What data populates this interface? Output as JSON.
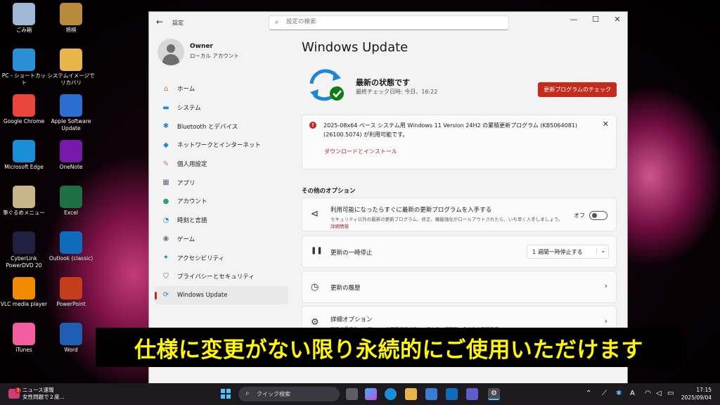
{
  "desktop": {
    "icons": [
      {
        "label": "ごみ箱",
        "icon": "recycle-bin-icon",
        "color": "#9fb8d6"
      },
      {
        "label": "将棋",
        "icon": "shogi-icon",
        "color": "#b98a3c"
      },
      {
        "label": "PC - ショートカット",
        "icon": "pc-icon",
        "color": "#2b8fd6"
      },
      {
        "label": "システムイメージでリカバリ",
        "icon": "folder-icon",
        "color": "#e7b54a"
      },
      {
        "label": "Google Chrome",
        "icon": "chrome-icon",
        "color": "#e8453c"
      },
      {
        "label": "Apple Software Update",
        "icon": "apple-update-icon",
        "color": "#2a6fd0"
      },
      {
        "label": "Microsoft Edge",
        "icon": "edge-icon",
        "color": "#1a8ed6"
      },
      {
        "label": "OneNote",
        "icon": "onenote-icon",
        "color": "#7719aa"
      },
      {
        "label": "筆ぐるめメニュー",
        "icon": "fudegurume-icon",
        "color": "#c9b58a"
      },
      {
        "label": "Excel",
        "icon": "excel-icon",
        "color": "#1d7044"
      },
      {
        "label": "CyberLink PowerDVD 20",
        "icon": "powerdvd-icon",
        "color": "#202040"
      },
      {
        "label": "Outlook (classic)",
        "icon": "outlook-icon",
        "color": "#0f6cbd"
      },
      {
        "label": "VLC media player",
        "icon": "vlc-icon",
        "color": "#f08a00"
      },
      {
        "label": "PowerPoint",
        "icon": "powerpoint-icon",
        "color": "#c43e1c"
      },
      {
        "label": "iTunes",
        "icon": "itunes-icon",
        "color": "#f25ea0"
      },
      {
        "label": "Word",
        "icon": "word-icon",
        "color": "#1e5fb4"
      }
    ]
  },
  "window": {
    "title": "設定",
    "search_placeholder": "設定の検索",
    "minimize": "—",
    "maximize": "☐",
    "close": "✕",
    "back": "←"
  },
  "user": {
    "name": "Owner",
    "subtitle": "ローカル アカウント"
  },
  "nav": [
    {
      "label": "ホーム",
      "icon": "home-icon",
      "glyph": "⌂",
      "color": "#c77a3c"
    },
    {
      "label": "システム",
      "icon": "system-icon",
      "glyph": "▬",
      "color": "#1f86d6"
    },
    {
      "label": "Bluetooth とデバイス",
      "icon": "bluetooth-icon",
      "glyph": "✱",
      "color": "#1f86d6"
    },
    {
      "label": "ネットワークとインターネット",
      "icon": "network-icon",
      "glyph": "◆",
      "color": "#1f86d6"
    },
    {
      "label": "個人用設定",
      "icon": "personalization-icon",
      "glyph": "✎",
      "color": "#c2813a"
    },
    {
      "label": "アプリ",
      "icon": "apps-icon",
      "glyph": "▦",
      "color": "#5a6a7a"
    },
    {
      "label": "アカウント",
      "icon": "account-icon",
      "glyph": "●",
      "color": "#2aa26b"
    },
    {
      "label": "時刻と言語",
      "icon": "time-language-icon",
      "glyph": "◔",
      "color": "#1f86d6"
    },
    {
      "label": "ゲーム",
      "icon": "gaming-icon",
      "glyph": "◉",
      "color": "#6b7785"
    },
    {
      "label": "アクセシビリティ",
      "icon": "accessibility-icon",
      "glyph": "✦",
      "color": "#1f86d6"
    },
    {
      "label": "プライバシーとセキュリティ",
      "icon": "shield-icon",
      "glyph": "⛉",
      "color": "#5a6a7a"
    },
    {
      "label": "Windows Update",
      "icon": "windows-update-icon",
      "glyph": "⟳",
      "color": "#1f86d6"
    }
  ],
  "main": {
    "heading": "Windows Update",
    "status_title": "最新の状態です",
    "status_sub": "最終チェック日時: 今日、16:22",
    "check_button": "更新プログラムのチェック",
    "update_text": "2025-08x64 ベース システム用 Windows 11 Version 24H2 の累積更新プログラム (KB5064081) (26100.5074) が利用可能です。",
    "download_link": "ダウンロードとインストール",
    "close_glyph": "✕",
    "more_options": "その他のオプション",
    "options": [
      {
        "title": "利用可能になったらすぐに最新の更新プログラムを入手する",
        "sub": "セキュリティ以外の最新の更新プログラム、修正、機能強化がロールアウトされたら、いち早く入手しましょう。",
        "link": "詳細情報",
        "toggle_label": "オフ",
        "icon": "megaphone-icon",
        "glyph": "⊲"
      },
      {
        "title": "更新の一時停止",
        "dropdown": "1 週間一時停止する",
        "icon": "pause-icon",
        "glyph": "❚❚"
      },
      {
        "title": "更新の履歴",
        "icon": "history-icon",
        "glyph": "◷"
      },
      {
        "title": "詳細オプション",
        "sub": "配信の最適化、オプションの更新プログラム、アクティブ時間、その他の更新設定",
        "icon": "gears-icon",
        "glyph": "⚙"
      }
    ]
  },
  "banner": {
    "text": "仕様に変更がない限り永続的にご使用いただけます"
  },
  "taskbar": {
    "news_title": "ニュース速報",
    "news_sub": "女性問題で２度...",
    "news_badge": "3",
    "search_placeholder": "クイック検索",
    "time": "17:15",
    "date": "2025/09/04",
    "ime": "A"
  }
}
